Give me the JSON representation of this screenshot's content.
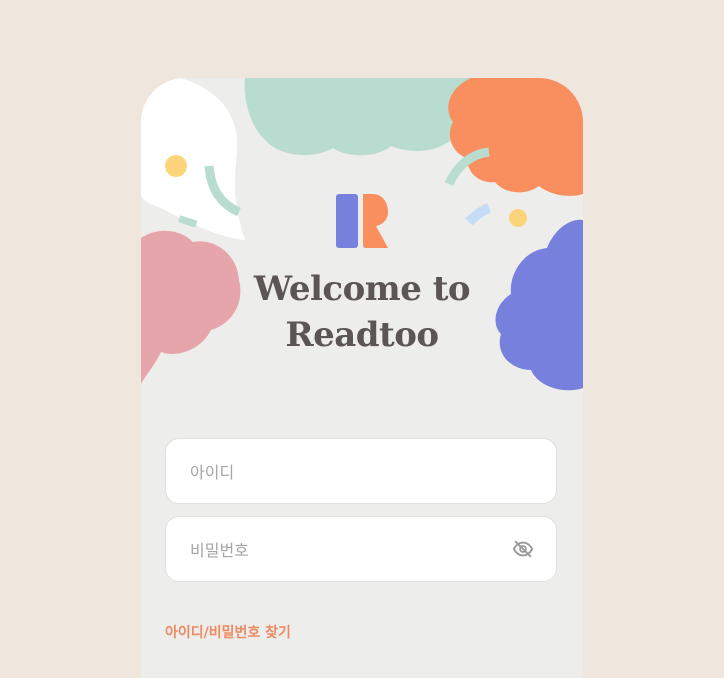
{
  "app": {
    "title_line1": "Welcome to",
    "title_line2": "Readtoo"
  },
  "login": {
    "id_placeholder": "아이디",
    "password_placeholder": "비밀번호",
    "find_link": "아이디/비밀번호 찾기"
  },
  "colors": {
    "page_background": "#efe7dd",
    "card_background": "#ededeb",
    "blob_mint": "#b9dcd0",
    "blob_orange": "#f98f5e",
    "blob_pink": "#e5a5ab",
    "blob_purple": "#7781dd",
    "dot_yellow": "#fcd57b",
    "link_orange": "#ee8a63",
    "title_text": "#5b5556"
  },
  "icons": {
    "logo": "readtoo-logo-icon",
    "password_toggle": "eye-off-icon"
  }
}
